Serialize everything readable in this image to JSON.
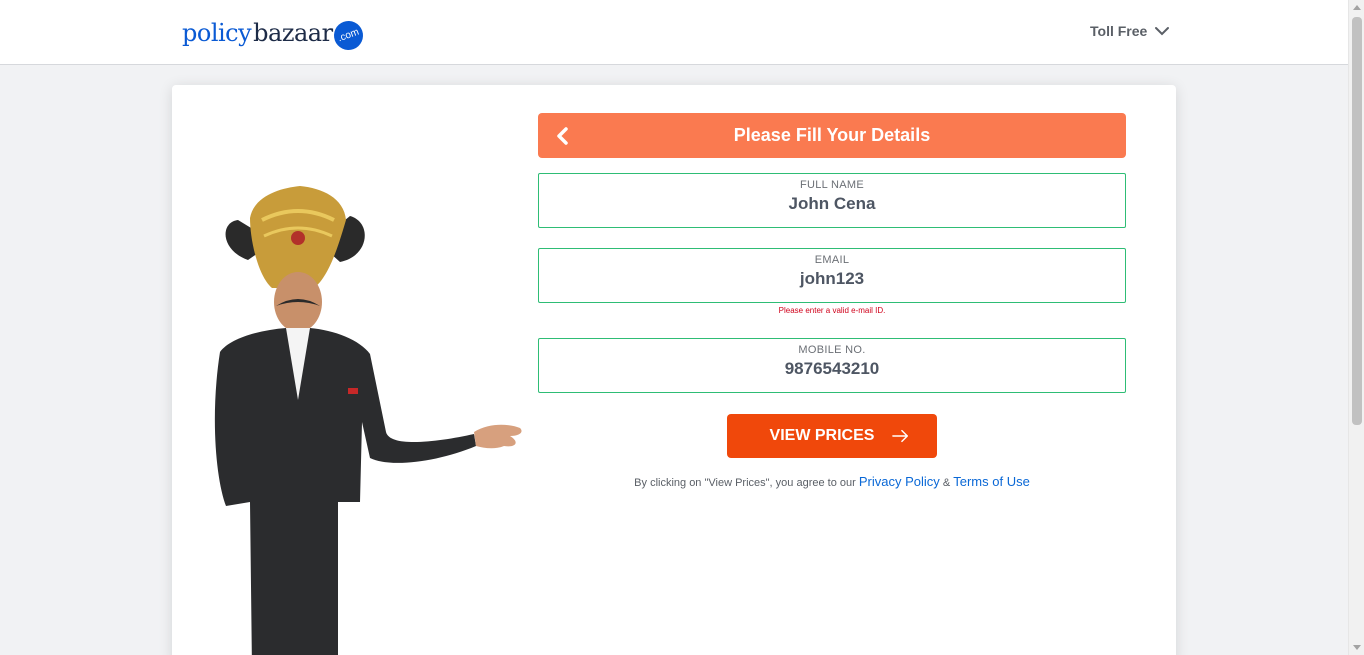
{
  "header": {
    "logo_policy": "policy",
    "logo_bazaar": "bazaar",
    "logo_com": ".com",
    "toll_free": "Toll Free"
  },
  "form": {
    "title": "Please Fill Your Details",
    "full_name": {
      "label": "FULL NAME",
      "value": "John Cena"
    },
    "email": {
      "label": "EMAIL",
      "value": "john123",
      "error": "Please enter a valid e-mail ID."
    },
    "mobile": {
      "label": "MOBILE NO.",
      "value": "9876543210"
    },
    "submit_label": "VIEW PRICES",
    "consent_prefix": "By clicking on \"View Prices\", you agree to our",
    "privacy_link": "Privacy Policy",
    "ampersand": "&",
    "terms_link": "Terms of Use"
  },
  "colors": {
    "brand_blue": "#0a5ad4",
    "header_orange": "#fa7a50",
    "button_orange": "#f0480b",
    "field_border_green": "#2ebd75",
    "error_red": "#d0021b"
  },
  "icons": {
    "toll_free": "chevron-down-icon",
    "back": "chevron-left-icon",
    "submit": "arrow-right-icon"
  }
}
